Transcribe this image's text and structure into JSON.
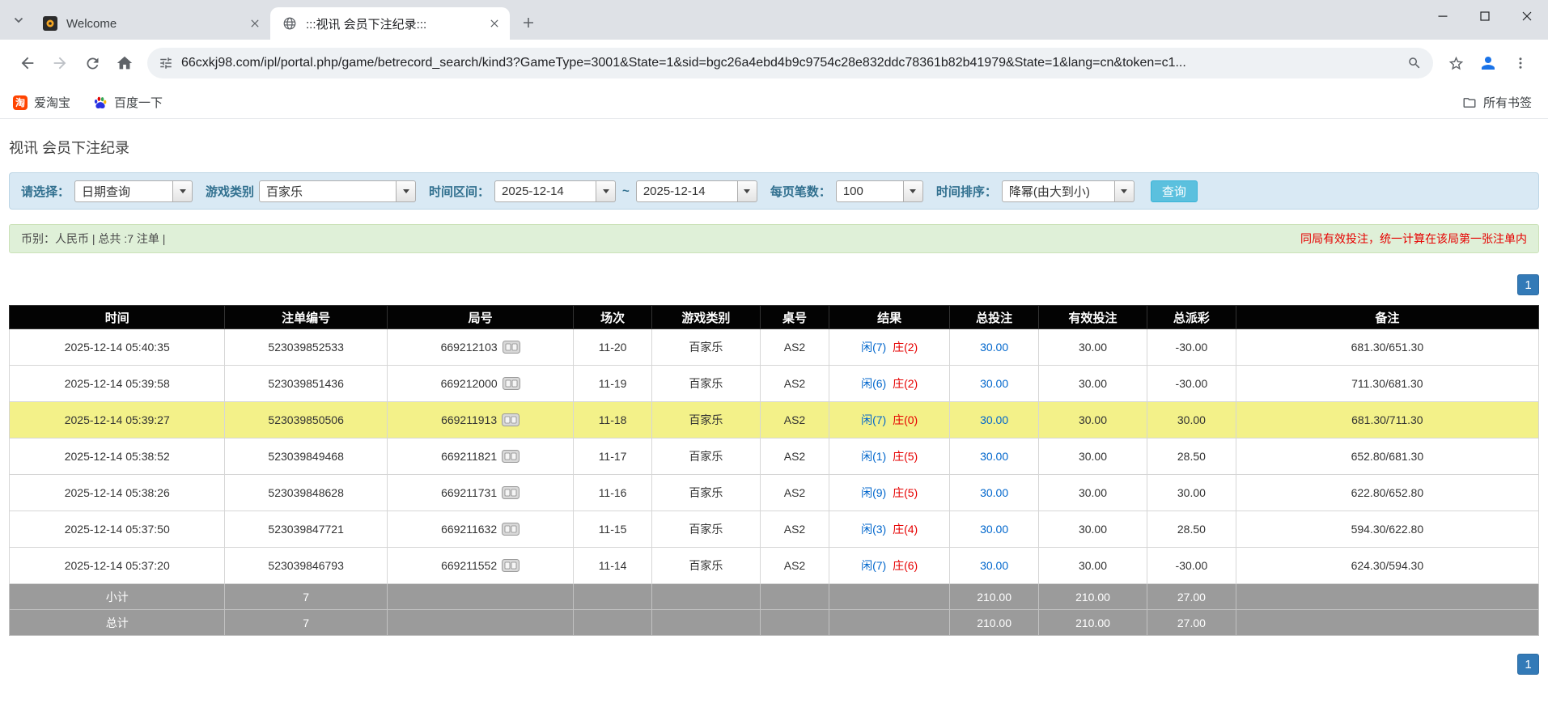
{
  "browser": {
    "tabs": [
      {
        "title": "Welcome"
      },
      {
        "title": ":::视讯 会员下注纪录:::"
      }
    ],
    "url": "66cxkj98.com/ipl/portal.php/game/betrecord_search/kind3?GameType=3001&State=1&sid=bgc26a4ebd4b9c9754c28e832ddc78361b82b41979&State=1&lang=cn&token=c1...",
    "bookmarks": {
      "aitaobao": "爱淘宝",
      "aitaobao_glyph": "淘",
      "baidu": "百度一下",
      "all_bookmarks": "所有书签"
    }
  },
  "page": {
    "title": "视讯 会员下注纪录",
    "filters": {
      "select_label": "请选择：",
      "select_value": "日期查询",
      "game_label": "游戏类别",
      "game_value": "百家乐",
      "range_label": "时间区间：",
      "date_from": "2025-12-14",
      "tilde": "~",
      "date_to": "2025-12-14",
      "per_page_label": "每页笔数：",
      "per_page_value": "100",
      "sort_label": "时间排序：",
      "sort_value": "降幂(由大到小)",
      "search_button": "查询"
    },
    "summary": {
      "left": "币别：人民币 | 总共 :7 注单 |",
      "right": "同局有效投注，统一计算在该局第一张注单内"
    },
    "pagination": {
      "page": "1"
    },
    "table": {
      "headers": [
        "时间",
        "注单编号",
        "局号",
        "场次",
        "游戏类别",
        "桌号",
        "结果",
        "总投注",
        "有效投注",
        "总派彩",
        "备注"
      ],
      "rows": [
        {
          "time": "2025-12-14 05:40:35",
          "bet_id": "523039852533",
          "round": "669212103",
          "session": "11-20",
          "game": "百家乐",
          "table_no": "AS2",
          "player": "闲(7)",
          "banker": "庄(2)",
          "total_bet": "30.00",
          "valid_bet": "30.00",
          "payout": "-30.00",
          "remark": "681.30/651.30",
          "highlight": false
        },
        {
          "time": "2025-12-14 05:39:58",
          "bet_id": "523039851436",
          "round": "669212000",
          "session": "11-19",
          "game": "百家乐",
          "table_no": "AS2",
          "player": "闲(6)",
          "banker": "庄(2)",
          "total_bet": "30.00",
          "valid_bet": "30.00",
          "payout": "-30.00",
          "remark": "711.30/681.30",
          "highlight": false
        },
        {
          "time": "2025-12-14 05:39:27",
          "bet_id": "523039850506",
          "round": "669211913",
          "session": "11-18",
          "game": "百家乐",
          "table_no": "AS2",
          "player": "闲(7)",
          "banker": "庄(0)",
          "total_bet": "30.00",
          "valid_bet": "30.00",
          "payout": "30.00",
          "remark": "681.30/711.30",
          "highlight": true
        },
        {
          "time": "2025-12-14 05:38:52",
          "bet_id": "523039849468",
          "round": "669211821",
          "session": "11-17",
          "game": "百家乐",
          "table_no": "AS2",
          "player": "闲(1)",
          "banker": "庄(5)",
          "total_bet": "30.00",
          "valid_bet": "30.00",
          "payout": "28.50",
          "remark": "652.80/681.30",
          "highlight": false
        },
        {
          "time": "2025-12-14 05:38:26",
          "bet_id": "523039848628",
          "round": "669211731",
          "session": "11-16",
          "game": "百家乐",
          "table_no": "AS2",
          "player": "闲(9)",
          "banker": "庄(5)",
          "total_bet": "30.00",
          "valid_bet": "30.00",
          "payout": "30.00",
          "remark": "622.80/652.80",
          "highlight": false
        },
        {
          "time": "2025-12-14 05:37:50",
          "bet_id": "523039847721",
          "round": "669211632",
          "session": "11-15",
          "game": "百家乐",
          "table_no": "AS2",
          "player": "闲(3)",
          "banker": "庄(4)",
          "total_bet": "30.00",
          "valid_bet": "30.00",
          "payout": "28.50",
          "remark": "594.30/622.80",
          "highlight": false
        },
        {
          "time": "2025-12-14 05:37:20",
          "bet_id": "523039846793",
          "round": "669211552",
          "session": "11-14",
          "game": "百家乐",
          "table_no": "AS2",
          "player": "闲(7)",
          "banker": "庄(6)",
          "total_bet": "30.00",
          "valid_bet": "30.00",
          "payout": "-30.00",
          "remark": "624.30/594.30",
          "highlight": false
        }
      ],
      "subtotal": {
        "label": "小计",
        "count": "7",
        "total_bet": "210.00",
        "valid_bet": "210.00",
        "payout": "27.00"
      },
      "total": {
        "label": "总计",
        "count": "7",
        "total_bet": "210.00",
        "valid_bet": "210.00",
        "payout": "27.00"
      }
    },
    "colors": {
      "pagination_bg": "#337ab7",
      "search_button_bg": "#5bc0de",
      "player_text": "#0066cc",
      "banker_text": "#e60000",
      "negative_payout": "#e60000",
      "bet_link": "#0066cc",
      "highlight_row": "#f3f189",
      "header_bg": "#030303",
      "footer_bg": "#9b9b9b",
      "filter_bg": "#d9e9f4",
      "summary_bg": "#dff0d8"
    }
  }
}
